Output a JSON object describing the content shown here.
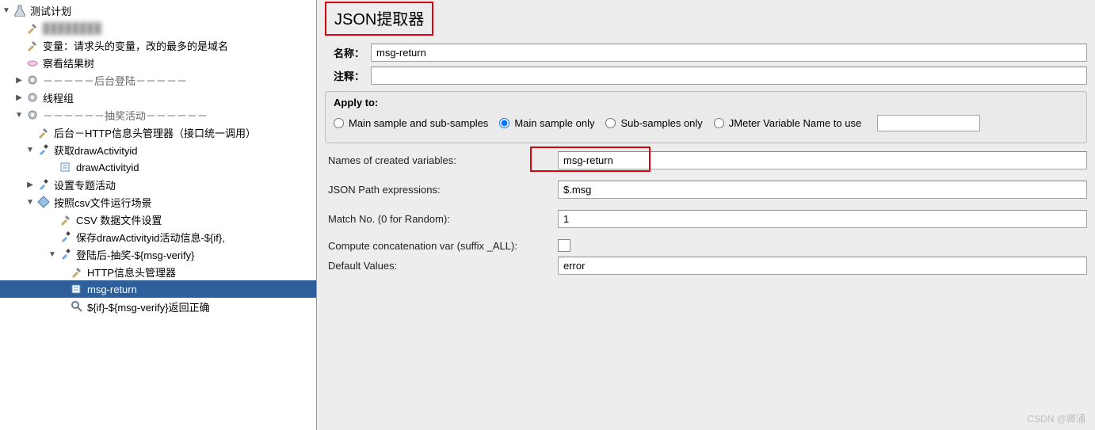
{
  "tree": {
    "root": "测试计划",
    "blurred_node": "████████",
    "variables": "变量：请求头的变量，改的最多的是域名",
    "view_tree": "察看结果树",
    "login_section": "－－－－－后台登陆－－－－－",
    "thread_group": "线程组",
    "lottery_section": "－－－－－－抽奖活动－－－－－－",
    "http_header_mgr": "后台－HTTP信息头管理器（接口统一调用）",
    "get_draw": "获取drawActivityid",
    "draw_id": "drawActivityid",
    "set_topic": "设置专题活动",
    "csv_scenario": "按照csv文件运行场景",
    "csv_settings": "CSV 数据文件设置",
    "save_draw": "保存drawActivityid活动信息-${if},",
    "login_lottery": "登陆后-抽奖-${msg-verify}",
    "http_header": "HTTP信息头管理器",
    "msg_return": "msg-return",
    "if_verify": "${if}-${msg-verify}返回正确"
  },
  "panel": {
    "title": "JSON提取器",
    "name_label": "名称：",
    "name_value": "msg-return",
    "comment_label": "注释：",
    "comment_value": "",
    "apply_label": "Apply to:",
    "radios": {
      "main_sub": "Main sample and sub-samples",
      "main_only": "Main sample only",
      "sub_only": "Sub-samples only",
      "jvar": "JMeter Variable Name to use"
    },
    "fields": {
      "names_label": "Names of created variables:",
      "names_value": "msg-return",
      "json_label": "JSON Path expressions:",
      "json_value": "$.msg",
      "match_label": "Match No. (0 for Random):",
      "match_value": "1",
      "concat_label": "Compute concatenation var (suffix _ALL):",
      "default_label": "Default Values:",
      "default_value": "error"
    }
  },
  "watermark": "CSDN @卿涌"
}
